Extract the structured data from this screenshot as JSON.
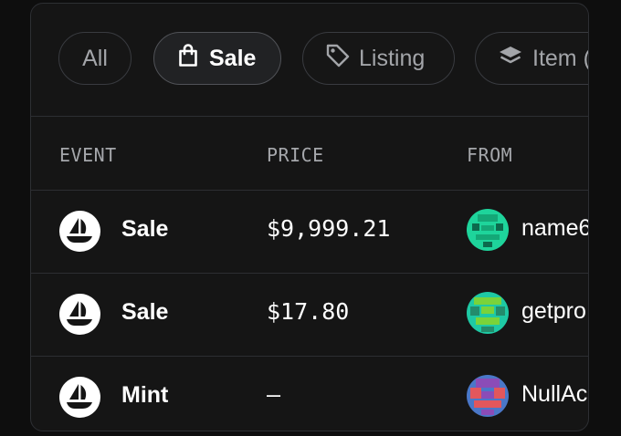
{
  "filters": [
    {
      "label": "All",
      "icon": "",
      "selected": false
    },
    {
      "label": "Sale",
      "icon": "shopping-bag-icon",
      "selected": true
    },
    {
      "label": "Listing",
      "icon": "tag-icon",
      "selected": false
    },
    {
      "label": "Item (",
      "icon": "layers-icon",
      "selected": false
    }
  ],
  "table": {
    "columns": [
      "EVENT",
      "PRICE",
      "FROM"
    ],
    "rows": [
      {
        "event": "Sale",
        "price": "$9,999.21",
        "from": "name6",
        "event_icon": "opensea-boat-icon",
        "avatar_colors": [
          "#1ed49b",
          "#14a877",
          "#0c6a4d"
        ]
      },
      {
        "event": "Sale",
        "price": "$17.80",
        "from": "getpro",
        "event_icon": "opensea-boat-icon",
        "avatar_colors": [
          "#1ec9a4",
          "#7ad33a",
          "#238c6c"
        ]
      },
      {
        "event": "Mint",
        "price": "–",
        "from": "NullAc",
        "event_icon": "opensea-boat-icon",
        "avatar_colors": [
          "#4a77c8",
          "#e2575c",
          "#8b4cb7"
        ]
      }
    ]
  },
  "colors": {
    "background": "#0e0e0e",
    "panel": "#151515",
    "border": "#2c2e32",
    "text_primary": "#ffffff",
    "text_secondary": "#a5a7ab"
  }
}
